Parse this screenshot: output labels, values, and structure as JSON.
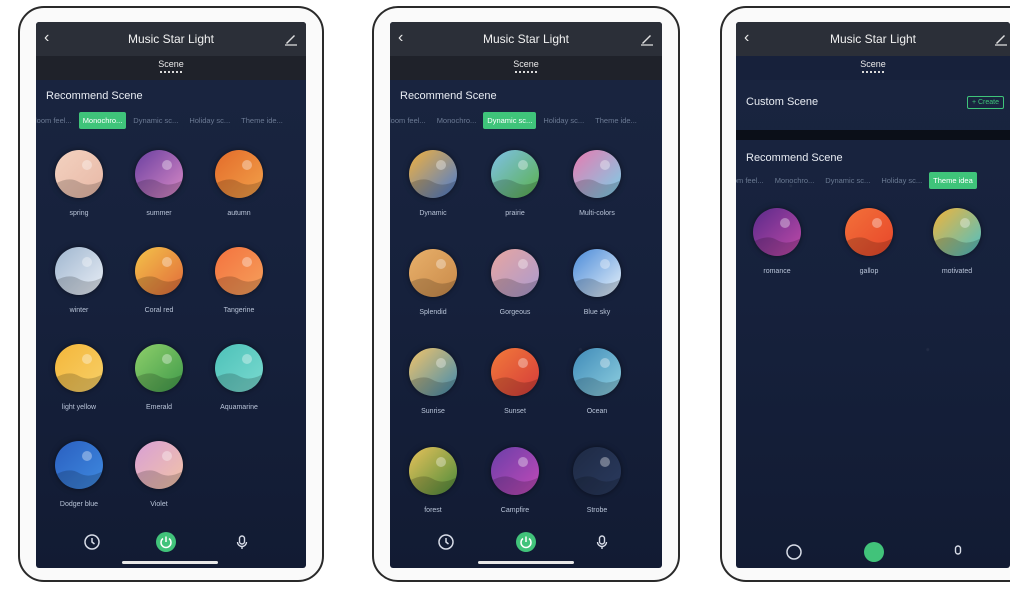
{
  "colors": {
    "accent": "#3fc47a",
    "bar": "#2b2f38",
    "bg": "#16213c"
  },
  "phones": [
    {
      "title": "Music Star Light",
      "tab": "Scene",
      "section": "Recommend Scene",
      "chips": [
        "Bloom feel...",
        "Monochro...",
        "Dynamic sc...",
        "Holiday sc...",
        "Theme ide..."
      ],
      "active_chip": 1,
      "scenes": [
        {
          "name": "spring",
          "colors": [
            "#f3d2c0",
            "#e8b8a6"
          ],
          "icon": "blossom-icon"
        },
        {
          "name": "summer",
          "colors": [
            "#6a3fa0",
            "#d98ac6"
          ],
          "icon": "night-forest-icon"
        },
        {
          "name": "autumn",
          "colors": [
            "#e36b2a",
            "#f2a14a"
          ],
          "icon": "pumpkin-icon"
        },
        {
          "name": "winter",
          "colors": [
            "#9fb6cf",
            "#e9eef6"
          ],
          "icon": "snow-mountain-icon"
        },
        {
          "name": "Coral red",
          "colors": [
            "#f3c34a",
            "#e26a3a"
          ],
          "icon": "sun-swirl-icon"
        },
        {
          "name": "Tangerine",
          "colors": [
            "#f3723e",
            "#f6a05c"
          ],
          "icon": "heart-icon"
        },
        {
          "name": "light yellow",
          "colors": [
            "#f4b63a",
            "#f7d068"
          ],
          "icon": "envelope-icon"
        },
        {
          "name": "Emerald",
          "colors": [
            "#8ecf6a",
            "#3f9a4a"
          ],
          "icon": "field-icon"
        },
        {
          "name": "Aquamarine",
          "colors": [
            "#4dc1b8",
            "#7adad0"
          ],
          "icon": "seal-icon"
        },
        {
          "name": "Dodger blue",
          "colors": [
            "#2a5fc0",
            "#3f8ae0"
          ],
          "icon": "blue-sphere-icon"
        },
        {
          "name": "Violet",
          "colors": [
            "#d89fd6",
            "#f2c4a6"
          ],
          "icon": "gradient-sphere-icon"
        }
      ]
    },
    {
      "title": "Music Star Light",
      "tab": "Scene",
      "section": "Recommend Scene",
      "chips": [
        "Bloom feel...",
        "Monochro...",
        "Dynamic sc...",
        "Holiday sc...",
        "Theme ide..."
      ],
      "active_chip": 2,
      "scenes": [
        {
          "name": "Dynamic",
          "colors": [
            "#f2b13e",
            "#4a7bd0"
          ],
          "icon": "waves-icon"
        },
        {
          "name": "prairie",
          "colors": [
            "#7fc1e8",
            "#5ab04a"
          ],
          "icon": "prairie-icon"
        },
        {
          "name": "Multi-colors",
          "colors": [
            "#e87ab0",
            "#7ad0e8"
          ],
          "icon": "rainbow-icon"
        },
        {
          "name": "Splendid",
          "colors": [
            "#e8b06a",
            "#c98a4a"
          ],
          "icon": "dunes-icon"
        },
        {
          "name": "Gorgeous",
          "colors": [
            "#e8a6a0",
            "#a99ad0"
          ],
          "icon": "clouds-icon"
        },
        {
          "name": "Blue sky",
          "colors": [
            "#4a8ad8",
            "#e8f2fa"
          ],
          "icon": "cloud-icon"
        },
        {
          "name": "Sunrise",
          "colors": [
            "#f2c46a",
            "#3f8ab0"
          ],
          "icon": "sunrise-icon"
        },
        {
          "name": "Sunset",
          "colors": [
            "#f27a3a",
            "#d43a3a"
          ],
          "icon": "palm-sunset-icon"
        },
        {
          "name": "Ocean",
          "colors": [
            "#3f8ab8",
            "#8fd0e0"
          ],
          "icon": "wave-icon"
        },
        {
          "name": "forest",
          "colors": [
            "#e8c25a",
            "#4a8a3a"
          ],
          "icon": "forest-icon"
        },
        {
          "name": "Campfire",
          "colors": [
            "#6a3fa8",
            "#c24ab8"
          ],
          "icon": "tent-icon"
        },
        {
          "name": "Strobe",
          "colors": [
            "#1e2a44",
            "#2a3a5e"
          ],
          "icon": "strobe-icon"
        }
      ]
    },
    {
      "title": "Music Star Light",
      "tab": "Scene",
      "custom_section": "Custom Scene",
      "create_label": "+ Create",
      "section": "Recommend Scene",
      "chips": [
        "Bloom feel...",
        "Monochro...",
        "Dynamic sc...",
        "Holiday sc...",
        "Theme idea"
      ],
      "active_chip": 4,
      "scenes": [
        {
          "name": "romance",
          "colors": [
            "#5a2a8a",
            "#c04aa8"
          ],
          "icon": "couple-icon"
        },
        {
          "name": "gallop",
          "colors": [
            "#f2713a",
            "#e8462a"
          ],
          "icon": "lines-icon"
        },
        {
          "name": "motivated",
          "colors": [
            "#f2b43a",
            "#4ac0c8"
          ],
          "icon": "squiggle-icon"
        }
      ]
    }
  ]
}
